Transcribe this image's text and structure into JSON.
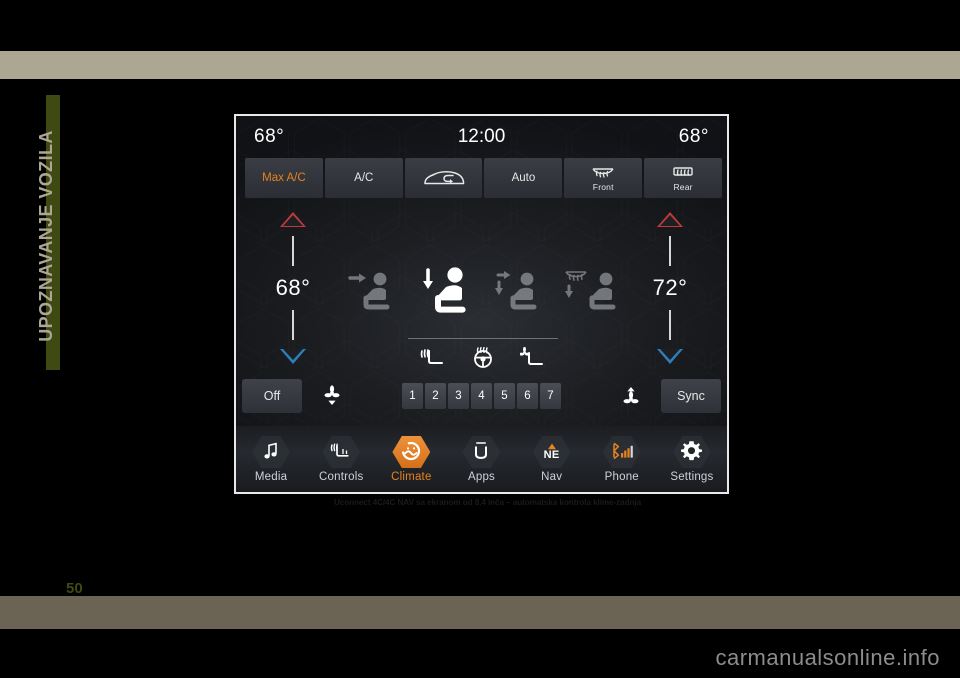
{
  "page": {
    "sidebar_label": "UPOZNAVANJE VOZILA",
    "page_number": "50",
    "watermark": "carmanualsonline.info",
    "caption": "Uconnect 4C/4C NAV sa ekranom od 8,4 inča – automatska kontrola klime-zadnja",
    "colors": {
      "band_top": "#ACA692",
      "band_bottom": "#6B6354",
      "sidebar_tab": "#3E4A12",
      "accent_orange": "#E8821E",
      "hot_red": "#C03A3A",
      "cold_blue": "#2C7FB8"
    }
  },
  "screen": {
    "status": {
      "left_temp": "68°",
      "clock": "12:00",
      "right_temp": "68°"
    },
    "top_buttons": [
      {
        "label": "Max A/C",
        "icon": "max-ac-text",
        "active": true,
        "sublabel": ""
      },
      {
        "label": "A/C",
        "icon": "ac-text",
        "active": false,
        "sublabel": ""
      },
      {
        "label": "",
        "icon": "recirculation-car-icon",
        "active": false,
        "sublabel": ""
      },
      {
        "label": "Auto",
        "icon": "auto-text",
        "active": false,
        "sublabel": ""
      },
      {
        "label": "",
        "icon": "defrost-front-icon",
        "active": false,
        "sublabel": "Front"
      },
      {
        "label": "",
        "icon": "defrost-rear-icon",
        "active": false,
        "sublabel": "Rear"
      }
    ],
    "left_zone": {
      "temperature": "68°",
      "increase_icon": "triangle-up-icon",
      "decrease_icon": "triangle-down-icon"
    },
    "right_zone": {
      "temperature": "72°",
      "increase_icon": "triangle-up-icon",
      "decrease_icon": "triangle-down-icon"
    },
    "airflow_modes": [
      {
        "name": "face-airflow-icon",
        "active": false
      },
      {
        "name": "face-floor-airflow-icon",
        "active": true
      },
      {
        "name": "floor-airflow-icon",
        "active": false
      },
      {
        "name": "defrost-floor-airflow-icon",
        "active": false
      }
    ],
    "comfort_icons": [
      {
        "name": "heated-seat-icon"
      },
      {
        "name": "heated-steering-wheel-icon"
      },
      {
        "name": "ventilated-seat-icon"
      }
    ],
    "fan_row": {
      "off_label": "Off",
      "decrease_fan_icon": "fan-decrease-icon",
      "increase_fan_icon": "fan-increase-icon",
      "sync_label": "Sync",
      "speeds": [
        "1",
        "2",
        "3",
        "4",
        "5",
        "6",
        "7"
      ]
    },
    "nav_items": [
      {
        "label": "Media",
        "icon": "music-note-icon",
        "active": false
      },
      {
        "label": "Controls",
        "icon": "controls-icon",
        "active": false
      },
      {
        "label": "Climate",
        "icon": "climate-icon",
        "active": true
      },
      {
        "label": "Apps",
        "icon": "apps-icon",
        "active": false
      },
      {
        "label": "Nav",
        "icon": "compass-ne-icon",
        "active": false
      },
      {
        "label": "Phone",
        "icon": "phone-signal-icon",
        "active": false
      },
      {
        "label": "Settings",
        "icon": "gear-icon",
        "active": false
      }
    ]
  }
}
